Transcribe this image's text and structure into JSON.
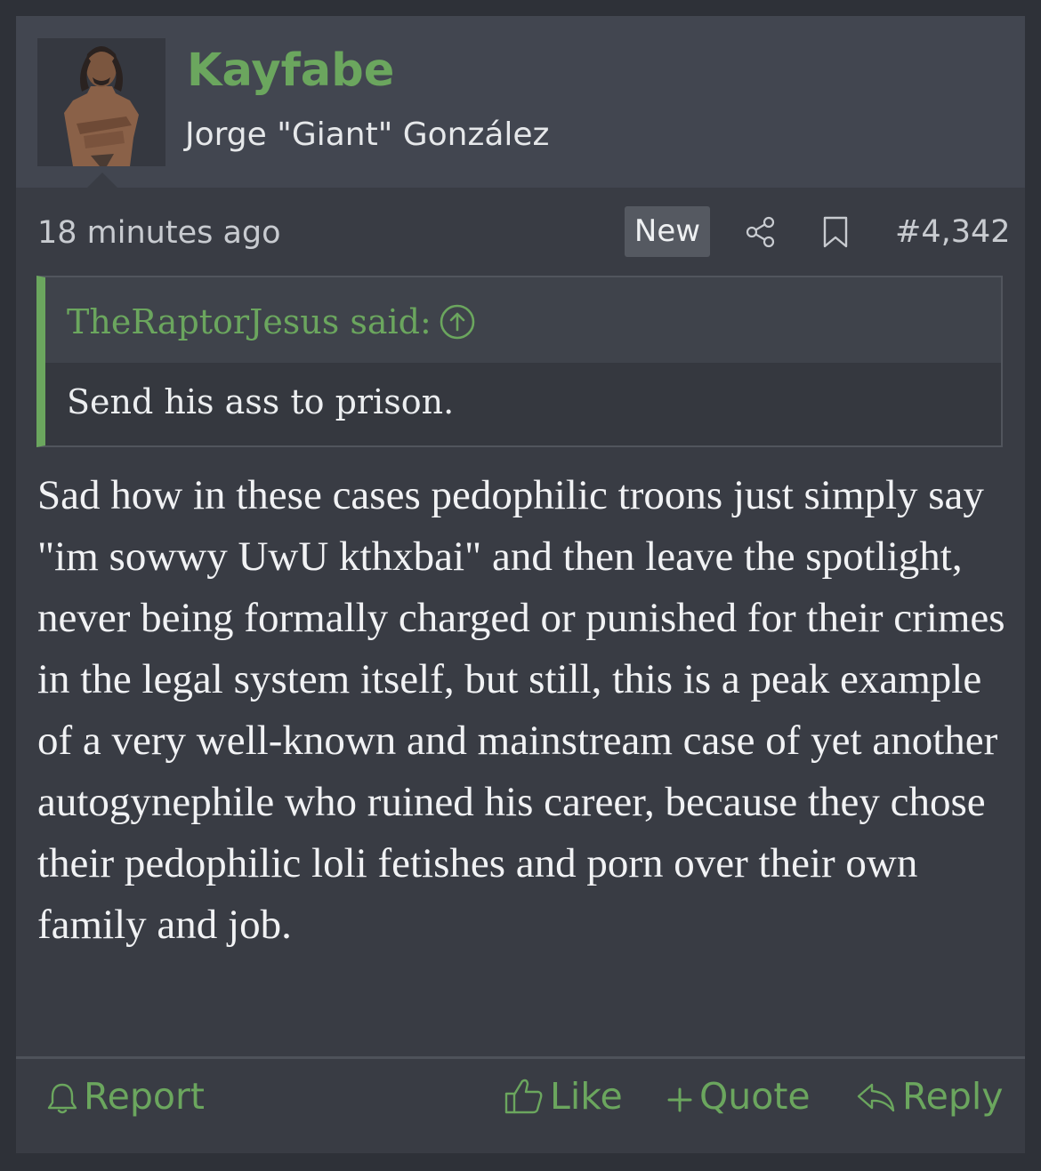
{
  "post": {
    "username": "Kayfabe",
    "user_title": "Jorge \"Giant\" González",
    "timestamp": "18 minutes ago",
    "new_badge": "New",
    "post_number": "#4,342",
    "quote": {
      "author": "TheRaptorJesus said:",
      "body": "Send his ass to prison."
    },
    "message": "Sad how in these cases pedophilic troons just simply say \"im sowwy UwU kthxbai\" and then leave the spotlight, never being formally charged or punished for their crimes in the legal system itself, but still, this is a peak example of a very well-known and mainstream case of yet another autogynephile who ruined his career, because they chose their pedophilic loli fetishes and porn over their own family and job.",
    "actions": {
      "report": "Report",
      "like": "Like",
      "quote": "Quote",
      "reply": "Reply"
    }
  },
  "icons": {
    "share": "share-icon",
    "bookmark": "bookmark-icon",
    "quote_jump": "arrow-up-circle-icon",
    "report": "bell-icon",
    "like": "thumbs-up-icon",
    "quote": "plus-icon",
    "reply": "reply-arrow-icon"
  },
  "colors": {
    "accent": "#6ba65e",
    "background": "#2e3138",
    "post_background": "#393c44",
    "header_background": "#424650"
  }
}
